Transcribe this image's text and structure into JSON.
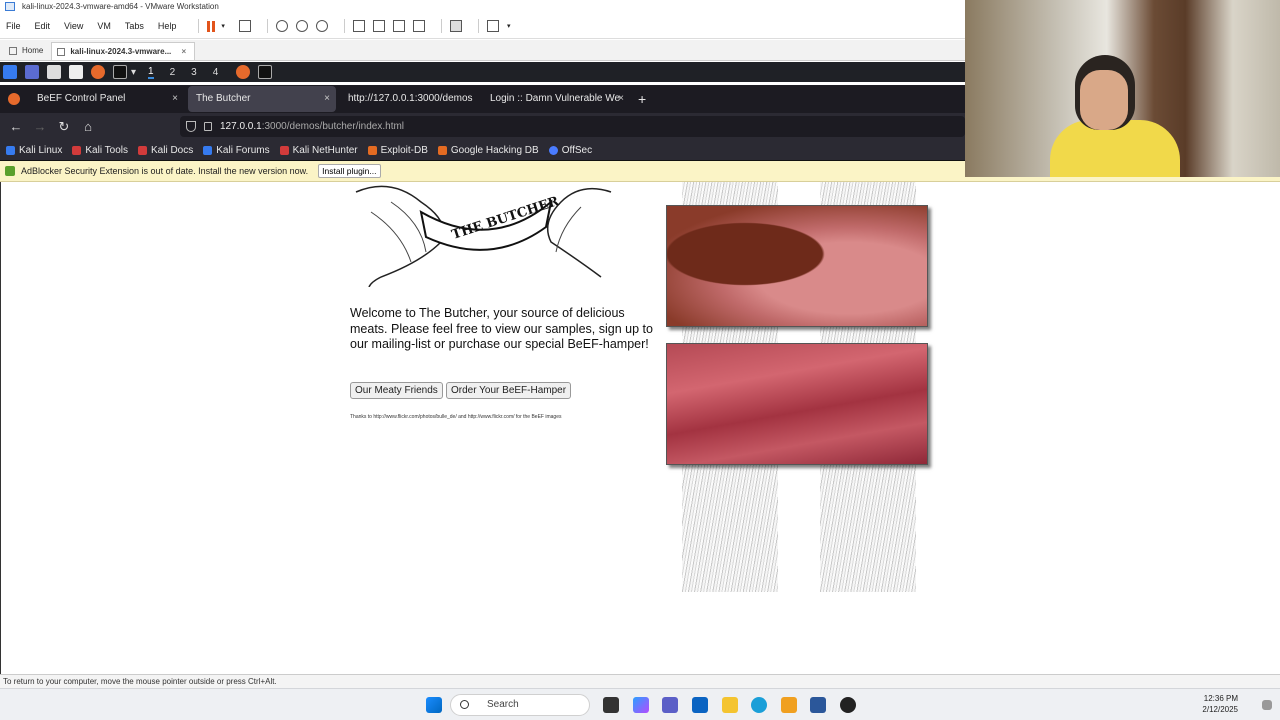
{
  "vmware": {
    "title": "kali-linux-2024.3-vmware-amd64 - VMware Workstation",
    "menu": [
      "File",
      "Edit",
      "View",
      "VM",
      "Tabs",
      "Help"
    ],
    "tabs": [
      {
        "label": "Home"
      },
      {
        "label": "kali-linux-2024.3-vmware..."
      }
    ],
    "status_text": "To return to your computer, move the mouse pointer outside or press Ctrl+Alt."
  },
  "kali_panel": {
    "workspaces": [
      "1",
      "2",
      "3",
      "4"
    ]
  },
  "firefox": {
    "tabs": [
      {
        "label": "BeEF Control Panel",
        "close": "×"
      },
      {
        "label": "The Butcher",
        "close": "×"
      },
      {
        "label": "http://127.0.0.1:3000/demos"
      },
      {
        "label": "Login :: Damn Vulnerable We",
        "close": "×"
      }
    ],
    "new_tab": "+",
    "url_host": "127.0.0.1",
    "url_rest": ":3000/demos/butcher/index.html",
    "bookmarks": [
      {
        "label": "Kali Linux",
        "color": "#367bf0"
      },
      {
        "label": "Kali Tools",
        "color": "#d23b3b"
      },
      {
        "label": "Kali Docs",
        "color": "#d23b3b"
      },
      {
        "label": "Kali Forums",
        "color": "#367bf0"
      },
      {
        "label": "Kali NetHunter",
        "color": "#d23b3b"
      },
      {
        "label": "Exploit-DB",
        "color": "#e46b22"
      },
      {
        "label": "Google Hacking DB",
        "color": "#e46b22"
      },
      {
        "label": "OffSec",
        "color": "#4a7cff"
      }
    ],
    "notification": {
      "text": "AdBlocker Security Extension is out of date. Install the new version now.",
      "button": "Install plugin..."
    }
  },
  "page": {
    "logo_text": "THE BUTCHER",
    "welcome": "Welcome to The Butcher, your source of delicious meats. Please feel free to view our samples, sign up to our mailing-list or purchase our special BeEF-hamper!",
    "btn_friends": "Our Meaty Friends",
    "btn_order": "Order Your BeEF-Hamper",
    "thanks": "Thanks to http://www.flickr.com/photos/bulle_de/ and http://www.flickr.com/ for the BeEF images"
  },
  "taskbar": {
    "search_placeholder": "Search",
    "time": "12:36 PM",
    "date": "2/12/2025"
  }
}
